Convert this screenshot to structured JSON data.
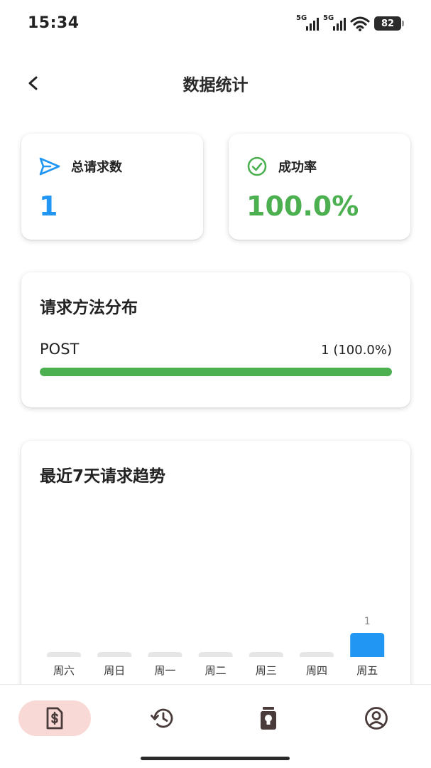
{
  "status_bar": {
    "time": "15:34",
    "network_1": "5G",
    "network_2": "5G",
    "battery": "82",
    "icons": [
      "signal-icon",
      "signal-icon",
      "wifi-icon",
      "battery-icon"
    ]
  },
  "app_bar": {
    "title": "数据统计",
    "back_icon": "back-arrow-icon"
  },
  "stats": {
    "total": {
      "label": "总请求数",
      "value": "1",
      "icon": "send-icon",
      "color": "#2196f3"
    },
    "success": {
      "label": "成功率",
      "value": "100.0%",
      "icon": "check-circle-icon",
      "color": "#4caf50"
    }
  },
  "methods": {
    "title": "请求方法分布",
    "items": [
      {
        "name": "POST",
        "count_text": "1 (100.0%)",
        "fraction": 1.0,
        "color": "#4caf50"
      }
    ]
  },
  "trend": {
    "title": "最近7天请求趋势"
  },
  "chart_data": {
    "type": "bar",
    "title": "最近7天请求趋势",
    "categories": [
      "周六",
      "周日",
      "周一",
      "周二",
      "周三",
      "周四",
      "周五"
    ],
    "values": [
      0,
      0,
      0,
      0,
      0,
      0,
      1
    ],
    "data_labels": [
      "",
      "",
      "",
      "",
      "",
      "",
      "1"
    ],
    "ylim": [
      0,
      1
    ],
    "grid": false,
    "bar_color": "#2196f3",
    "empty_bar_color": "#e6e6e6"
  },
  "bottom_nav": {
    "items": [
      {
        "icon": "invoice-dollar-icon",
        "active": true
      },
      {
        "icon": "history-icon",
        "active": false
      },
      {
        "icon": "lightbulb-jar-icon",
        "active": false
      },
      {
        "icon": "account-circle-icon",
        "active": false
      }
    ]
  },
  "colors": {
    "accent_blue": "#2196f3",
    "success_green": "#4caf50",
    "nav_active_bg": "#f9d9d6",
    "icon_dark": "#4a3b3b"
  }
}
